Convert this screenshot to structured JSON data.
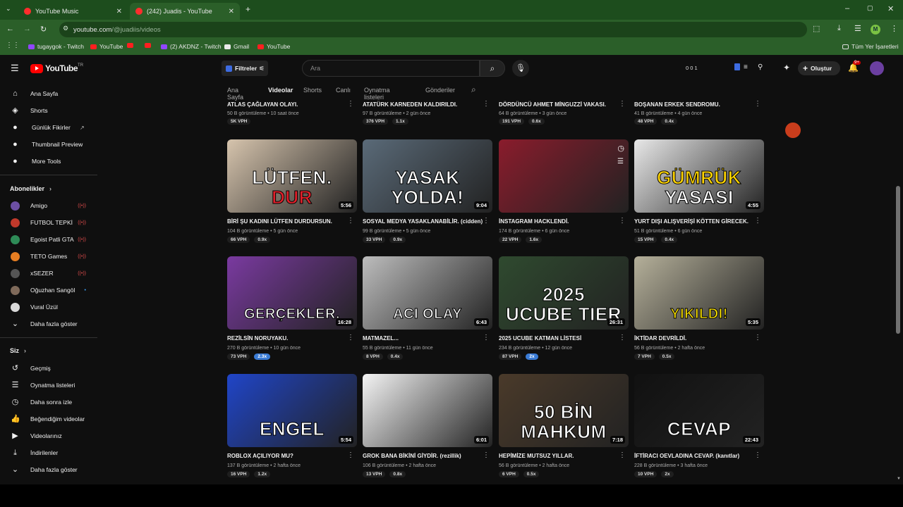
{
  "browser": {
    "tabs": [
      {
        "label": "YouTube Music",
        "close": "✕"
      },
      {
        "label": "(242) Juadis - YouTube",
        "close": "✕"
      }
    ],
    "new_tab": "+",
    "address": {
      "host": "youtube.com",
      "path": "/@juadiis/videos"
    },
    "bookmarks": [
      "tugaygok - Twitch",
      "YouTube",
      "",
      "",
      "(2) AKDNZ - Twitch",
      "Gmail",
      "YouTube"
    ],
    "all_bookmarks": "Tüm Yer İşaretleri",
    "profile_initial": "M"
  },
  "header": {
    "logo": "YouTube",
    "logo_region": "TR",
    "filters_label": "Filtreler",
    "search_placeholder": "Ara",
    "counters": "0  0  1",
    "create_label": "Oluştur",
    "notif_badge": "9+"
  },
  "sidebar": {
    "main": [
      {
        "label": "Ana Sayfa",
        "icon": "home-icon"
      },
      {
        "label": "Shorts",
        "icon": "shorts-icon"
      },
      {
        "label": "Günlük Fikirler",
        "icon": "ideas-icon"
      },
      {
        "label": "Thumbnail Preview",
        "icon": "preview-icon"
      },
      {
        "label": "More Tools",
        "icon": "tools-icon"
      }
    ],
    "subs_title": "Abonelikler",
    "subs": [
      {
        "label": "Amigo",
        "color": "#6c4fa3",
        "live": "((•))"
      },
      {
        "label": "FUTBOL TEPKİ",
        "color": "#c0392b",
        "live": "((•))"
      },
      {
        "label": "Egoist Patli GTA",
        "color": "#2e8b57",
        "live": "((•))"
      },
      {
        "label": "TETO Games",
        "color": "#e67e22",
        "live": "((•))"
      },
      {
        "label": "xSEZER",
        "color": "#555555",
        "live": "((•))"
      },
      {
        "label": "Oğuzhan Sangöl",
        "color": "#7f6a5a",
        "live": "•"
      },
      {
        "label": "Vural Üzül",
        "color": "#d9d9d9",
        "live": ""
      }
    ],
    "subs_more": "Daha fazla göster",
    "you_title": "Siz",
    "you": [
      {
        "label": "Geçmiş",
        "icon": "history-icon"
      },
      {
        "label": "Oynatma listeleri",
        "icon": "playlist-icon"
      },
      {
        "label": "Daha sonra izle",
        "icon": "clock-icon"
      },
      {
        "label": "Beğendiğim videolar",
        "icon": "like-icon"
      },
      {
        "label": "Videolarınız",
        "icon": "video-icon"
      },
      {
        "label": "İndirilenler",
        "icon": "download-icon"
      }
    ],
    "you_more": "Daha fazla göster"
  },
  "channel_tabs": [
    "Ana Sayfa",
    "Videolar",
    "Shorts",
    "Canlı",
    "Oynatma listeleri",
    "Gönderiler"
  ],
  "top_row": [
    {
      "title": "ATLAS ÇAĞLAYAN OLAYI.",
      "meta": "50 B görüntüleme • 10 saat önce",
      "vph": "5K VPH",
      "ratio": ""
    },
    {
      "title": "ATATÜRK KARNEDEN KALDIRILDI.",
      "meta": "97 B görüntüleme • 2 gün önce",
      "vph": "376 VPH",
      "ratio": "1.1x"
    },
    {
      "title": "DÖRDÜNCÜ AHMET MİNGUZZİ VAKASI.",
      "meta": "64 B görüntüleme • 3 gün önce",
      "vph": "191 VPH",
      "ratio": "0.6x"
    },
    {
      "title": "BOŞANAN ERKEK SENDROMU.",
      "meta": "41 B görüntüleme • 4 gün önce",
      "vph": "48 VPH",
      "ratio": "0.4x"
    }
  ],
  "videos": [
    {
      "title": "BİRİ ŞU KADINI LÜTFEN DURDURSUN.",
      "meta": "104 B görüntüleme • 5 gün önce",
      "vph": "66 VPH",
      "ratio": "0.9x",
      "dur": "5:56",
      "thumb_text": "LÜTFEN.",
      "thumb_text2": "DUR",
      "bg": "#d6c4ad"
    },
    {
      "title": "SOSYAL MEDYA YASAKLANABİLİR. (cidden)",
      "meta": "99 B görüntüleme • 5 gün önce",
      "vph": "33 VPH",
      "ratio": "0.9x",
      "dur": "9:04",
      "thumb_text": "YASAK",
      "thumb_text2": "YOLDA!",
      "bg": "#5a6a78"
    },
    {
      "title": "İNSTAGRAM HACKLENDİ.",
      "meta": "174 B görüntüleme • 6 gün önce",
      "vph": "22 VPH",
      "ratio": "1.6x",
      "dur": "",
      "thumb_text": "",
      "thumb_text2": "",
      "bg": "#8a1c2c"
    },
    {
      "title": "YURT DIŞI ALIŞVERİŞİ KÖTTEN GİRECEK.",
      "meta": "51 B görüntüleme • 6 gün önce",
      "vph": "15 VPH",
      "ratio": "0.4x",
      "dur": "4:55",
      "thumb_text": "GÜMRÜK",
      "thumb_text2": "YASASI",
      "bg": "#e8e8e8"
    },
    {
      "title": "REZİLSİN NORUYAKU.",
      "meta": "270 B görüntüleme • 10 gün önce",
      "vph": "73 VPH",
      "ratio": "2.3x",
      "dur": "16:28",
      "thumb_text": "GERÇEKLER.",
      "thumb_text2": "",
      "bg": "#7a3aa0"
    },
    {
      "title": "MATMAZEL...",
      "meta": "55 B görüntüleme • 11 gün önce",
      "vph": "8 VPH",
      "ratio": "0.4x",
      "dur": "6:43",
      "thumb_text": "ACI OLAY",
      "thumb_text2": "",
      "bg": "#bdbdbd"
    },
    {
      "title": "2025 UCUBE KATMAN LİSTESİ",
      "meta": "234 B görüntüleme • 12 gün önce",
      "vph": "87 VPH",
      "ratio": "2x",
      "dur": "26:31",
      "thumb_text": "2025",
      "thumb_text2": "UCUBE TIER",
      "bg": "#2f4a2f"
    },
    {
      "title": "İKTİDAR DEVRİLDİ.",
      "meta": "56 B görüntüleme • 2 hafta önce",
      "vph": "7 VPH",
      "ratio": "0.5x",
      "dur": "5:35",
      "thumb_text": "YIKILDI!",
      "thumb_text2": "",
      "bg": "#b5b09a"
    },
    {
      "title": "ROBLOX AÇILIYOR MU?",
      "meta": "137 B görüntüleme • 2 hafta önce",
      "vph": "16 VPH",
      "ratio": "1.2x",
      "dur": "5:54",
      "thumb_text": "ENGEL",
      "thumb_text2": "",
      "bg": "#2045c8"
    },
    {
      "title": "GROK BANA BİKİNİ GİYDİR. (rezillik)",
      "meta": "106 B görüntüleme • 2 hafta önce",
      "vph": "13 VPH",
      "ratio": "0.8x",
      "dur": "6:01",
      "thumb_text": "",
      "thumb_text2": "",
      "bg": "#f4f4f4"
    },
    {
      "title": "HEPİMİZE MUTSUZ YILLAR.",
      "meta": "56 B görüntüleme • 2 hafta önce",
      "vph": "6 VPH",
      "ratio": "0.5x",
      "dur": "7:18",
      "thumb_text": "50 BİN",
      "thumb_text2": "MAHKUM",
      "bg": "#4a3a2a"
    },
    {
      "title": "İFTİRACI OEVLADINA CEVAP. (kanıtlar)",
      "meta": "228 B görüntüleme • 3 hafta önce",
      "vph": "10 VPH",
      "ratio": "2x",
      "dur": "22:43",
      "thumb_text": "CEVAP",
      "thumb_text2": "",
      "bg": "#111111"
    }
  ]
}
